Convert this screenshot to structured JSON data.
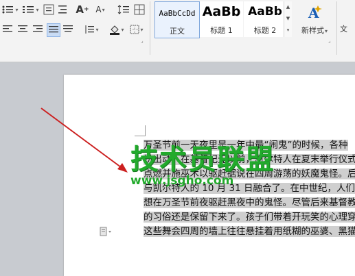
{
  "styles": {
    "normal": {
      "sample": "AaBbCcDd",
      "name": "正文"
    },
    "heading1": {
      "sample": "AaBb",
      "name": "标题 1"
    },
    "heading2": {
      "sample": "AaBb",
      "name": "标题 2"
    }
  },
  "new_style": {
    "label": "新样式",
    "caret": "▾"
  },
  "text_tool": {
    "label": "文"
  },
  "toolbar": {
    "font_size_up": "A",
    "font_size_down": "A",
    "clear_format": "A",
    "caret": "▾"
  },
  "document": {
    "lines": [
      "万圣节前一天夜里是一年中最“闹鬼”的时候，各种",
      "纷出动。在基督纪元以前，凯尔特人在夏末举行仪式",
      "点燃并施巫术以驱赶据说在四周游荡的妖魔鬼怪。后",
      "与凯尔特人的 10 月 31 日融合了。在中世纪，人们穿",
      "想在万圣节前夜驱赶黑夜中的鬼怪。尽管后来基督教",
      "的习俗还是保留下来了。孩子们带着开玩笑的心理穿",
      "这些舞会四周的墙上往往悬挂着用纸糊的巫婆、黑猫"
    ]
  },
  "watermark": {
    "main": "技术员联盟",
    "url": "www.jsgho.com"
  },
  "colors": {
    "arrow": "#cc2020",
    "selection": "#cfcfcf",
    "watermark": "#22aa2c"
  }
}
